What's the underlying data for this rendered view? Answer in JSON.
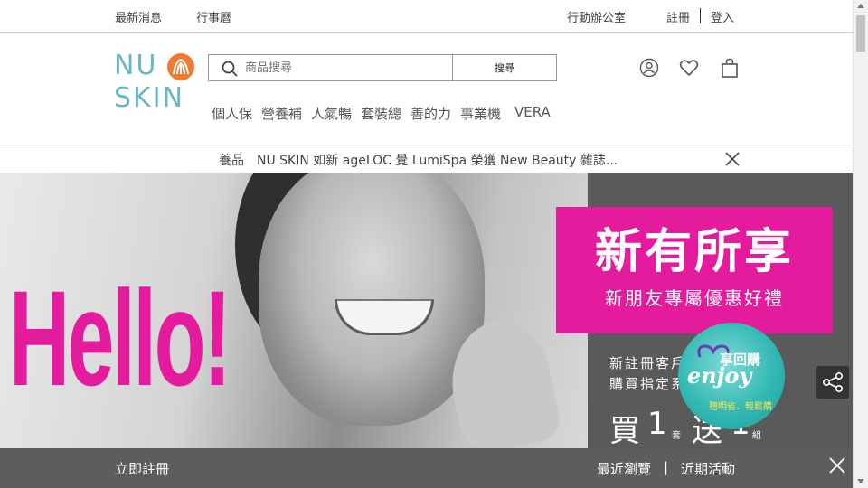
{
  "topbar": {
    "news": "最新消息",
    "calendar": "行事曆",
    "mobile_office": "行動辦公室",
    "register": "註冊",
    "login": "登入"
  },
  "header": {
    "logo_line1": "NU",
    "logo_line2": "SKIN",
    "search_placeholder": "商品搜尋",
    "search_button": "搜尋",
    "icons": [
      "account-icon",
      "heart-icon",
      "shopping-bag-icon"
    ]
  },
  "nav": {
    "items": [
      "個人保",
      "營養補",
      "人氣暢",
      "套裝總",
      "善的力",
      "事業機",
      "VERA"
    ]
  },
  "announcement": {
    "text": "養品　NU SKIN 如新 ageLOC 覺 LumiSpa 榮獲 New Beauty 雜誌..."
  },
  "hero": {
    "hello": "Hello!",
    "headline": "新有所享",
    "subheadline": "新朋友專屬優惠好禮",
    "desc_line1": "新註冊客戶",
    "desc_line2": "購買指定系",
    "offer_buy": "買",
    "offer_num1": "1",
    "offer_unit1": "套",
    "offer_send": "送",
    "offer_num2": "1",
    "offer_unit2": "組",
    "badge_top": "享回購",
    "badge_main": "enjoy",
    "badge_sub": "聰明省．輕鬆購"
  },
  "bottombar": {
    "signup": "立即註冊",
    "recent": "最近瀏覽",
    "divider": "|",
    "events": "近期活動"
  },
  "colors": {
    "brand_teal": "#6ab7c3",
    "logo_orange": "#f07a2f",
    "hero_pink": "#e31b9c",
    "bottom_bar": "#5d5d5d"
  }
}
